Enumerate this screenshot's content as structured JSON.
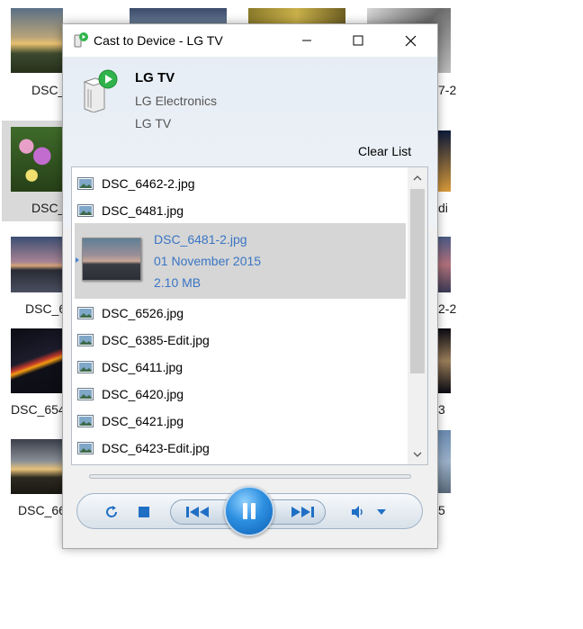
{
  "background": {
    "labels": [
      "DSC_",
      "DSC_",
      "DSC_6",
      "DSC_654",
      "DSC_66",
      "7-2",
      "di",
      "2-2",
      "3",
      "5"
    ]
  },
  "window": {
    "title": "Cast to Device - LG TV",
    "minimize_label": "Minimize",
    "maximize_label": "Maximize",
    "close_label": "Close"
  },
  "device": {
    "name": "LG TV",
    "manufacturer": "LG Electronics",
    "model": "LG TV"
  },
  "clear_list_label": "Clear List",
  "playlist": {
    "items_before": [
      "DSC_6462-2.jpg",
      "DSC_6481.jpg"
    ],
    "active": {
      "name": "DSC_6481-2.jpg",
      "date": "01 November 2015",
      "size": "2.10 MB"
    },
    "items_after": [
      "DSC_6526.jpg",
      "DSC_6385-Edit.jpg",
      "DSC_6411.jpg",
      "DSC_6420.jpg",
      "DSC_6421.jpg",
      "DSC_6423-Edit.jpg"
    ]
  },
  "controls": {
    "icons": [
      "repeat-icon",
      "stop-icon",
      "previous-icon",
      "pause-icon",
      "next-icon",
      "volume-icon",
      "dropdown-arrow-icon"
    ]
  },
  "colors": {
    "accent": "#3a75c4",
    "selection": "#d6d6d6",
    "pause_button": "#2d8fe0"
  }
}
